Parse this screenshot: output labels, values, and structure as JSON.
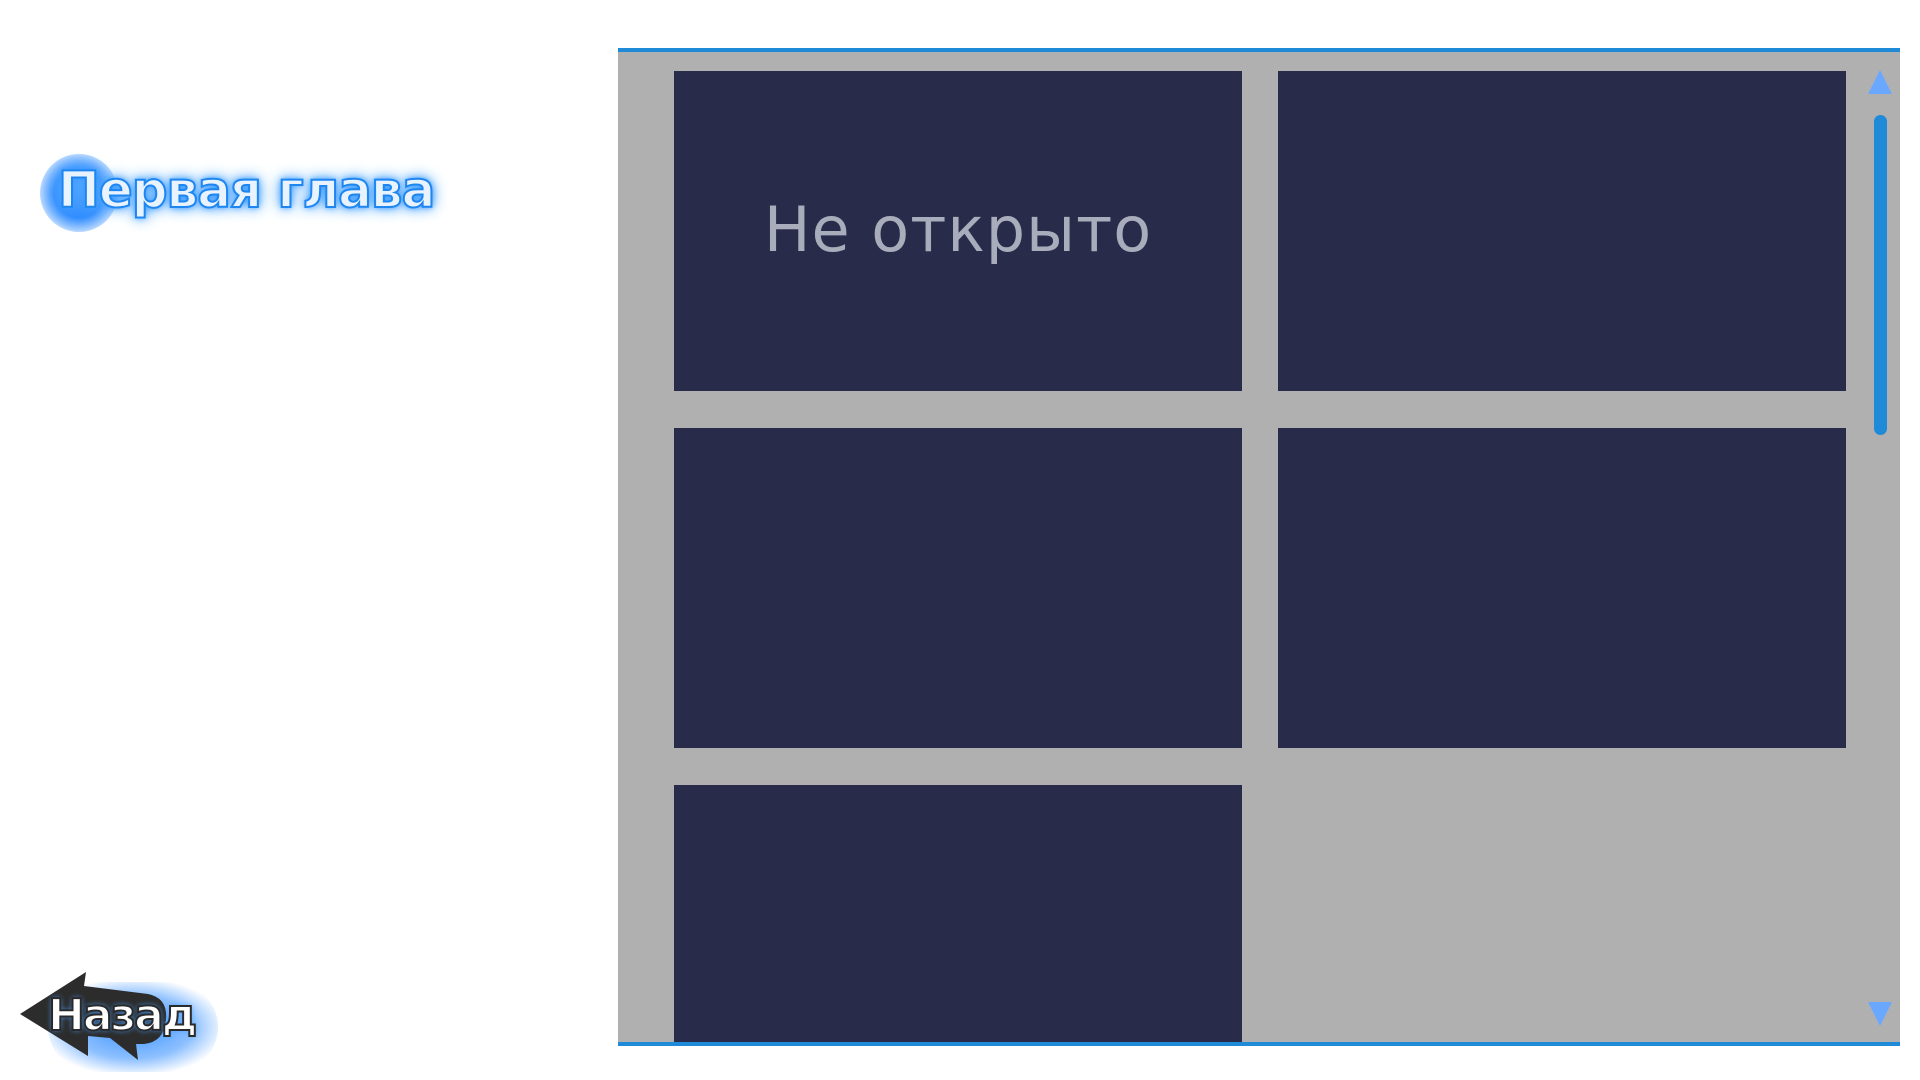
{
  "chapter": {
    "label": "Первая глава"
  },
  "gallery": {
    "items": [
      {
        "label": "Не открыто"
      },
      {
        "label": ""
      },
      {
        "label": ""
      },
      {
        "label": ""
      },
      {
        "label": ""
      }
    ],
    "scroll_up_icon": "triangle-up-icon",
    "scroll_down_icon": "triangle-down-icon"
  },
  "back": {
    "label": "Назад",
    "icon": "arrow-left-icon"
  },
  "colors": {
    "accent": "#1f8ad8",
    "glow": "#2f8cff",
    "panel": "#b0b0b0",
    "thumb": "#282c4a"
  }
}
